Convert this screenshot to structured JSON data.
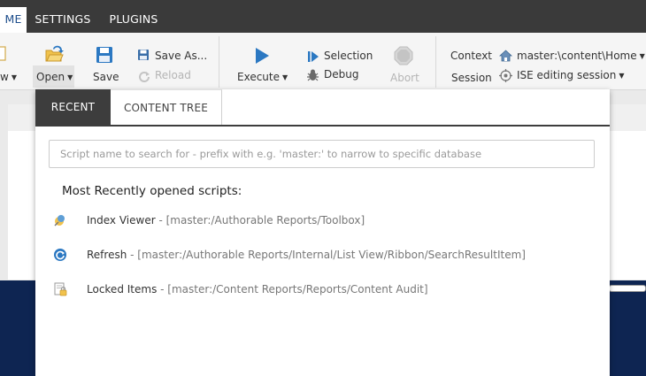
{
  "top_tabs": [
    {
      "label": "ME"
    },
    {
      "label": "SETTINGS"
    },
    {
      "label": "PLUGINS"
    }
  ],
  "ribbon": {
    "new_label": "w",
    "open_label": "Open",
    "save_label": "Save",
    "save_as_label": "Save As...",
    "reload_label": "Reload",
    "execute_label": "Execute",
    "selection_label": "Selection",
    "debug_label": "Debug",
    "abort_label": "Abort",
    "context_label": "Context",
    "context_value": "master:\\content\\Home",
    "session_label": "Session",
    "session_value": "ISE editing session"
  },
  "panel": {
    "tabs": [
      {
        "label": "RECENT"
      },
      {
        "label": "CONTENT TREE"
      }
    ],
    "search_placeholder": "Script name to search for - prefix with e.g. 'master:' to narrow to specific database",
    "heading": "Most Recently opened scripts:",
    "items": [
      {
        "name": "Index Viewer",
        "sep": " - ",
        "path": "[master:/Authorable Reports/Toolbox]",
        "icon": "index-viewer-icon"
      },
      {
        "name": "Refresh",
        "sep": " - ",
        "path": "[master:/Authorable Reports/Internal/List View/Ribbon/SearchResultItem]",
        "icon": "refresh-icon"
      },
      {
        "name": "Locked Items",
        "sep": " - ",
        "path": "[master:/Content Reports/Reports/Content Audit]",
        "icon": "locked-items-icon"
      }
    ]
  },
  "colors": {
    "top_bar": "#3a3a3a",
    "accent_blue": "#2b78c2",
    "background_navy": "#0e2552",
    "active_tab_dark": "#3d3d3d"
  }
}
